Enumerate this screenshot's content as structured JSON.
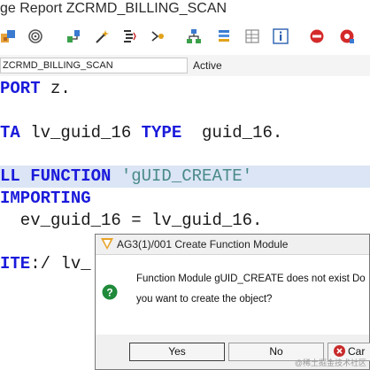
{
  "window": {
    "title": "ge Report ZCRMD_BILLING_SCAN"
  },
  "toolbar": {
    "icons": [
      "transport-icon",
      "spiral-icon",
      "where-used-icon",
      "magic-wand-icon",
      "pretty-printer-icon",
      "navigate-icon",
      "hierarchy-icon",
      "stack-icon",
      "table-grid-icon",
      "info-icon",
      "stop-icon",
      "debug-icon"
    ]
  },
  "infobar": {
    "program": "ZCRMD_BILLING_SCAN",
    "status": "Active"
  },
  "editor": {
    "l1": {
      "a": "PORT",
      "b": " z."
    },
    "l2": {
      "a": "TA",
      "b": " lv_guid_16 ",
      "c": "TYPE",
      "d": "  guid_16."
    },
    "l3": {
      "a": "LL FUNCTION",
      "b": " ",
      "c": "'gUID_CREATE'"
    },
    "l4": {
      "a": "IMPORTING"
    },
    "l5": {
      "a": "  ev_guid_16 = lv_guid_16."
    },
    "l6": {
      "a": "ITE",
      "b": ":/ lv_"
    }
  },
  "dialog": {
    "title": "AG3(1)/001 Create Function Module",
    "message_line1": "Function Module gUID_CREATE does not exist Do",
    "message_line2": "you want to create the object?",
    "yes_label": "Yes",
    "no_label": "No",
    "cancel_label": "Car"
  },
  "watermark": "@稀土掘金技术社区",
  "colors": {
    "keyword": "#1a1adb",
    "string": "#4a8a8a",
    "highlight": "#dbe5f5"
  }
}
